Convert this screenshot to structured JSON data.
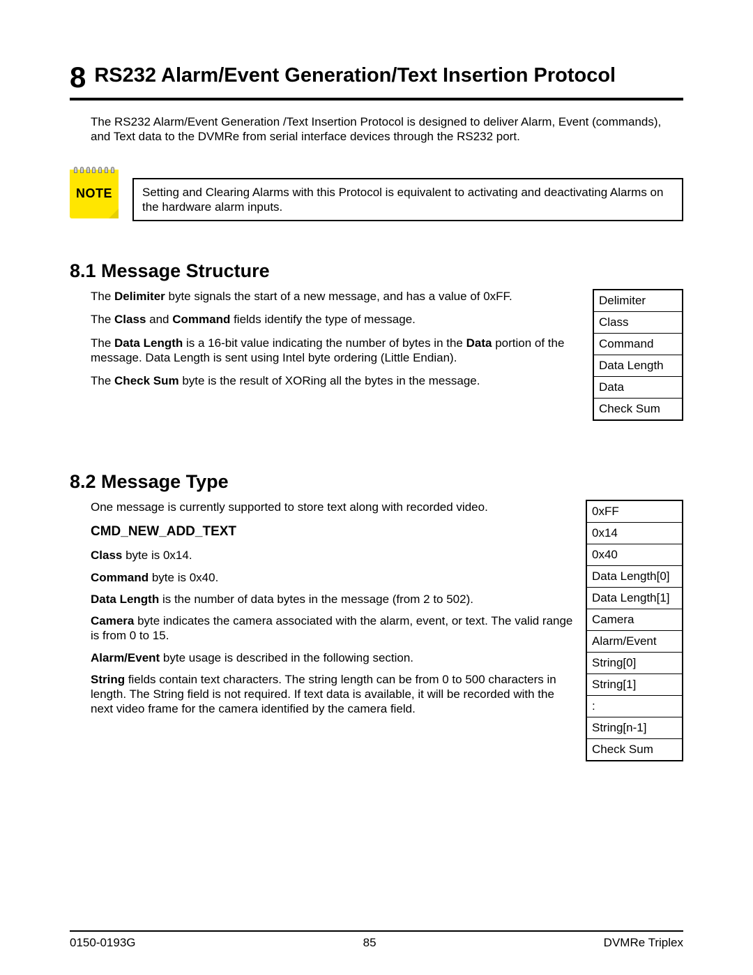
{
  "chapter": {
    "number": "8",
    "title": "RS232 Alarm/Event Generation/Text Insertion Protocol"
  },
  "intro": "The RS232 Alarm/Event Generation /Text Insertion Protocol is designed to deliver Alarm, Event (commands), and Text data to the DVMRe from serial interface devices through the RS232 port.",
  "note": {
    "label": "NOTE",
    "text": "Setting and Clearing Alarms with this Protocol is equivalent to activating and deactivating Alarms on the hardware alarm inputs."
  },
  "section81": {
    "heading": "8.1  Message Structure",
    "p1a": "The ",
    "p1b": "Delimiter",
    "p1c": " byte signals the start of a new message, and has a value of 0xFF.",
    "p2a": "The ",
    "p2b": "Class",
    "p2c": " and ",
    "p2d": "Command",
    "p2e": " fields identify the type of message.",
    "p3a": "The ",
    "p3b": "Data Length",
    "p3c": " is a 16-bit value indicating the number of bytes in the ",
    "p3d": "Data",
    "p3e": " portion of the message.  Data Length is sent using Intel byte ordering (Little Endian).",
    "p4a": "The ",
    "p4b": "Check Sum",
    "p4c": " byte is the result of XORing all the bytes in the message.",
    "table": [
      "Delimiter",
      "Class",
      "Command",
      "Data Length",
      "Data",
      "Check Sum"
    ]
  },
  "section82": {
    "heading": "8.2  Message Type",
    "intro": "One message is currently supported to store text along with recorded video.",
    "sub": "CMD_NEW_ADD_TEXT",
    "p1a": "Class",
    "p1b": " byte is 0x14.",
    "p2a": "Command",
    "p2b": " byte is 0x40.",
    "p3a": "Data Length",
    "p3b": " is the number of data bytes in the message (from 2 to 502).",
    "p4a": "Camera",
    "p4b": " byte indicates the camera associated with the alarm, event, or text.  The valid range is from 0 to 15.",
    "p5a": "Alarm/Event",
    "p5b": " byte usage is described in the following section.",
    "p6a": "String",
    "p6b": " fields contain text characters.  The string length can be from 0 to 500 characters in length. The String field is not required. If text data is available, it will be recorded with the next video frame for the camera identified by the camera field.",
    "table": [
      "0xFF",
      "0x14",
      "0x40",
      "Data Length[0]",
      "Data Length[1]",
      "Camera",
      "Alarm/Event",
      "String[0]",
      "String[1]",
      ":",
      "String[n-1]",
      "Check Sum"
    ]
  },
  "footer": {
    "left": "0150-0193G",
    "center": "85",
    "right": "DVMRe Triplex"
  }
}
